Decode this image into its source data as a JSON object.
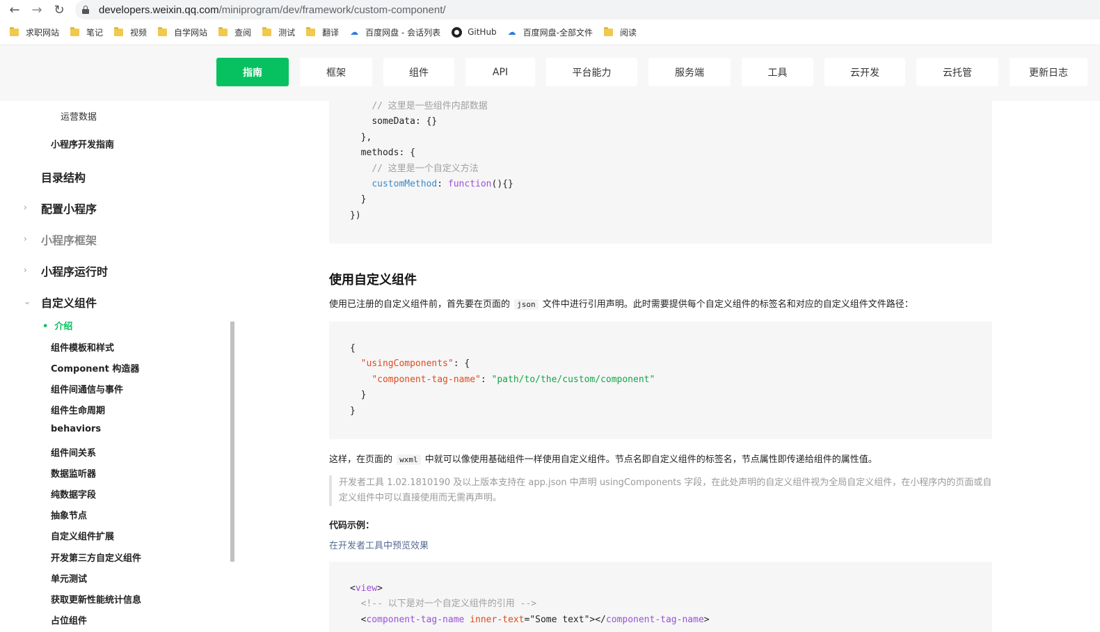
{
  "browser": {
    "url_host": "developers.weixin.qq.com",
    "url_path": "/miniprogram/dev/framework/custom-component/",
    "bookmarks": [
      {
        "icon": "folder-icon",
        "label": "求职网站"
      },
      {
        "icon": "folder-icon",
        "label": "笔记"
      },
      {
        "icon": "folder-icon",
        "label": "视频"
      },
      {
        "icon": "folder-icon",
        "label": "自学网站"
      },
      {
        "icon": "folder-icon",
        "label": "查阅"
      },
      {
        "icon": "folder-icon",
        "label": "测试"
      },
      {
        "icon": "folder-icon",
        "label": "翻译"
      },
      {
        "icon": "baidu-cloud-icon",
        "label": "百度网盘 - 会话列表"
      },
      {
        "icon": "github-icon",
        "label": "GitHub"
      },
      {
        "icon": "baidu-cloud-icon",
        "label": "百度网盘-全部文件"
      },
      {
        "icon": "folder-icon",
        "label": "阅读"
      }
    ]
  },
  "topnav": {
    "tabs": [
      "指南",
      "框架",
      "组件",
      "API",
      "平台能力",
      "服务端",
      "工具",
      "云开发",
      "云托管",
      "更新日志"
    ],
    "active": "指南"
  },
  "sidebar": {
    "ops_data": "运营数据",
    "dev_guide": "小程序开发指南",
    "dir_structure": "目录结构",
    "config": "配置小程序",
    "framework": "小程序框架",
    "runtime": "小程序运行时",
    "custom_component": "自定义组件",
    "intro": "介绍",
    "children": [
      "组件模板和样式",
      "Component 构造器",
      "组件间通信与事件",
      "组件生命周期",
      "behaviors",
      "组件间关系",
      "数据监听器",
      "纯数据字段",
      "抽象节点",
      "自定义组件扩展",
      "开发第三方自定义组件",
      "单元测试",
      "获取更新性能统计信息",
      "占位组件"
    ]
  },
  "content": {
    "code1": {
      "comment_data": "// 这里是一些组件内部数据",
      "some_data": "someData",
      "methods": "methods",
      "comment_method": "// 这里是一个自定义方法",
      "custom_method": "customMethod",
      "function_kw": "function"
    },
    "heading": "使用自定义组件",
    "para1_before": "使用已注册的自定义组件前，首先要在页面的",
    "para1_code": "json",
    "para1_after": "文件中进行引用声明。此时需要提供每个自定义组件的标签名和对应的自定义组件文件路径：",
    "code2": {
      "using_components": "\"usingComponents\"",
      "tag_name_key": "\"component-tag-name\"",
      "path_value": "\"path/to/the/custom/component\""
    },
    "para2_before": "这样，在页面的",
    "para2_code": "wxml",
    "para2_after": "中就可以像使用基础组件一样使用自定义组件。节点名即自定义组件的标签名，节点属性即传递给组件的属性值。",
    "note": "开发者工具 1.02.1810190 及以上版本支持在 app.json 中声明 usingComponents 字段，在此处声明的自定义组件视为全局自定义组件，在小程序内的页面或自定义组件中可以直接使用而无需再声明。",
    "example_label": "代码示例：",
    "preview_link": "在开发者工具中预览效果",
    "code3": {
      "view_tag": "view",
      "comment": "<!-- 以下是对一个自定义组件的引用 -->",
      "component_tag": "component-tag-name",
      "attr": "inner-text",
      "attr_value": "\"Some text\""
    }
  },
  "colors": {
    "accent": "#07c160",
    "link": "#576b95"
  }
}
